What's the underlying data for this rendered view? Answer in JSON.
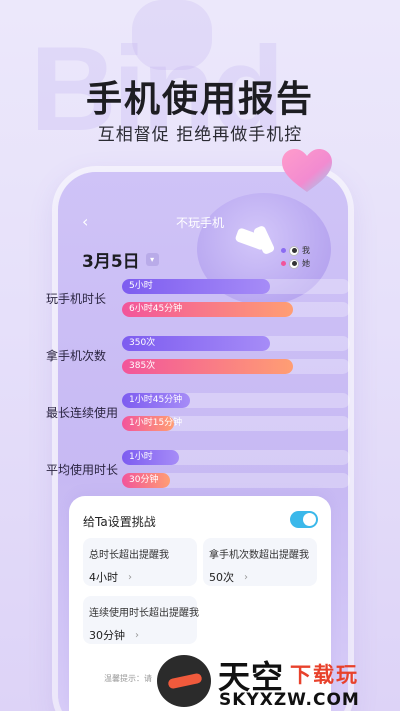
{
  "hero": {
    "bg_word": "Bind",
    "title": "手机使用报告",
    "subtitle": "互相督促  拒绝再做手机控"
  },
  "screen": {
    "back_icon": "chevron-left-icon",
    "title": "不玩手机",
    "date": "3月5日",
    "legend": {
      "me": "我",
      "her": "她",
      "me_color": "#8b6cf2",
      "her_color": "#f2559b"
    }
  },
  "metrics": [
    {
      "label": "玩手机时长",
      "me_value": "5小时",
      "her_value": "6小时45分钟",
      "me_fraction": 0.65,
      "her_fraction": 0.75
    },
    {
      "label": "拿手机次数",
      "me_value": "350次",
      "her_value": "385次",
      "me_fraction": 0.65,
      "her_fraction": 0.75
    },
    {
      "label": "最长连续使用",
      "me_value": "1小时45分钟",
      "her_value": "1小时15分钟",
      "me_fraction": 0.3,
      "her_fraction": 0.23
    },
    {
      "label": "平均使用时长",
      "me_value": "1小时",
      "her_value": "30分钟",
      "me_fraction": 0.25,
      "her_fraction": 0.13
    }
  ],
  "challenge": {
    "title": "给Ta设置挑战",
    "enabled": true,
    "cards": [
      {
        "label": "总时长超出提醒我",
        "value": "4小时"
      },
      {
        "label": "拿手机次数超出提醒我",
        "value": "50次"
      },
      {
        "label": "连续使用时长超出提醒我",
        "value": "30分钟"
      }
    ],
    "tip": "温馨提示：请"
  },
  "watermark": {
    "main": "天空",
    "accent": "下载玩",
    "url": "SKYXZW.COM"
  },
  "colors": {
    "accent": "#8b6cf2",
    "toggle_on": "#3bb8ea",
    "her": "#f2559b"
  }
}
